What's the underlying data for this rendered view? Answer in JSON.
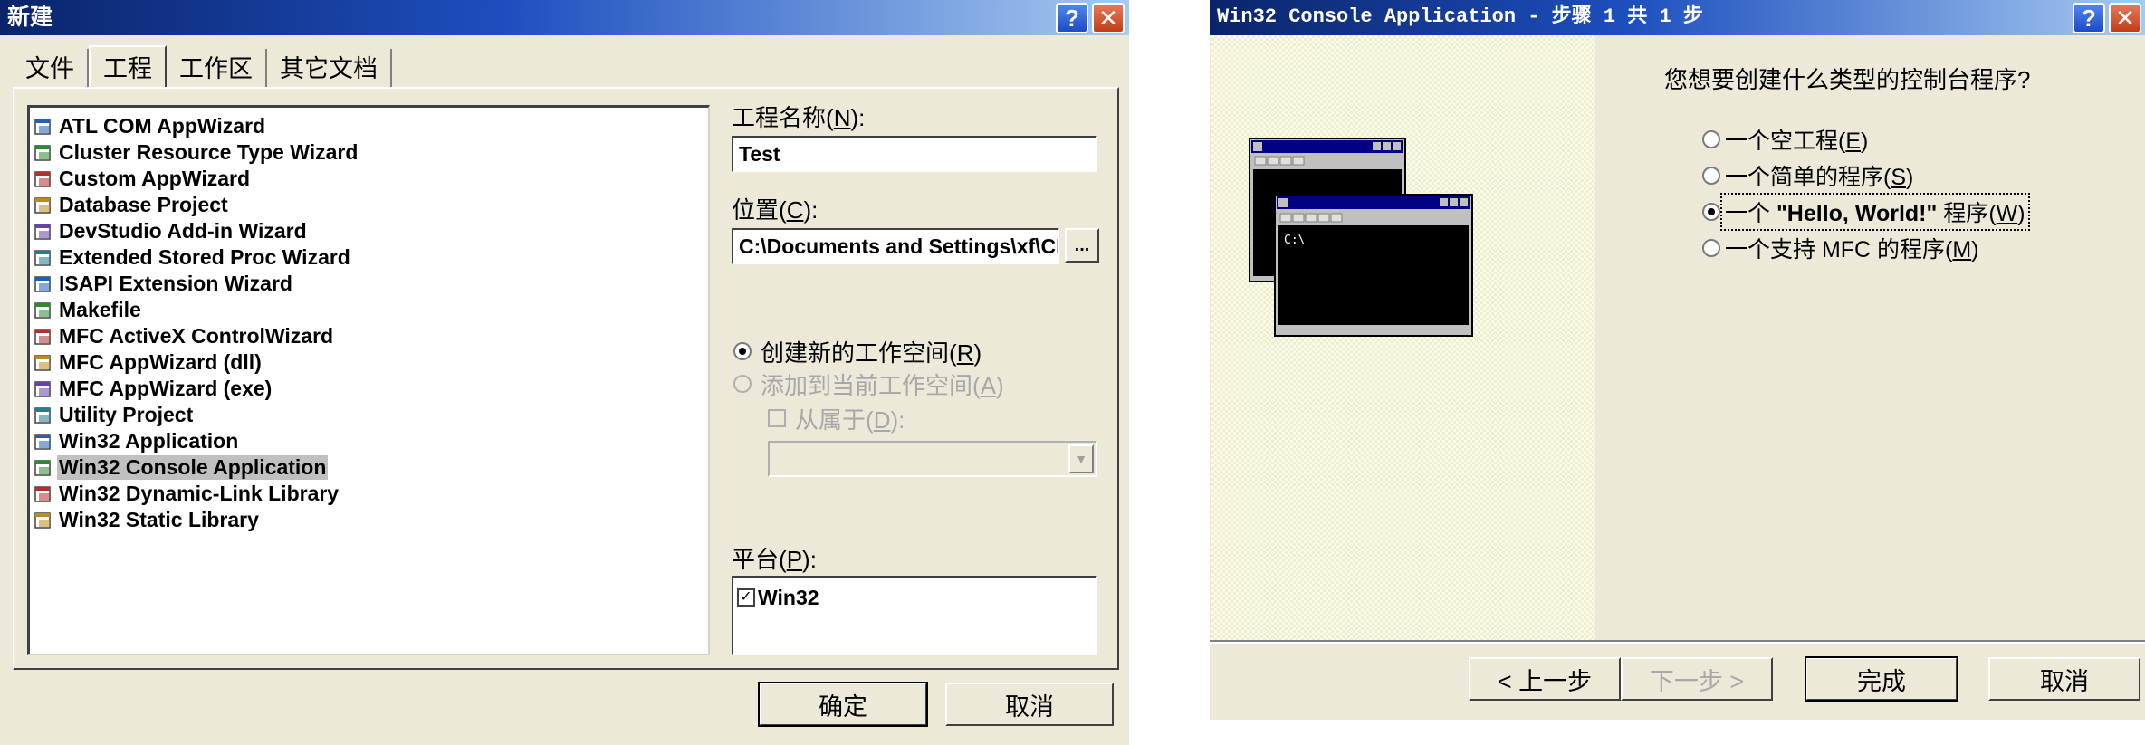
{
  "new_dialog": {
    "title": "新建",
    "help_btn": "?",
    "close_btn": "✕",
    "tabs": [
      "文件",
      "工程",
      "工作区",
      "其它文档"
    ],
    "active_tab": 1,
    "project_types": [
      "ATL COM AppWizard",
      "Cluster Resource Type Wizard",
      "Custom AppWizard",
      "Database Project",
      "DevStudio Add-in Wizard",
      "Extended Stored Proc Wizard",
      "ISAPI Extension Wizard",
      "Makefile",
      "MFC ActiveX ControlWizard",
      "MFC AppWizard (dll)",
      "MFC AppWizard (exe)",
      "Utility Project",
      "Win32 Application",
      "Win32 Console Application",
      "Win32 Dynamic-Link Library",
      "Win32 Static Library"
    ],
    "selected_project_type": "Win32 Console Application",
    "project_name": {
      "label": "工程名称",
      "hotkey": "N",
      "value": "Test"
    },
    "location": {
      "label": "位置",
      "hotkey": "C",
      "value": "C:\\Documents and Settings\\xf\\CF",
      "browse": "..."
    },
    "workspace_options": [
      {
        "label": "创建新的工作空间",
        "hotkey": "R",
        "selected": true,
        "enabled": true
      },
      {
        "label": "添加到当前工作空间",
        "hotkey": "A",
        "selected": false,
        "enabled": false
      }
    ],
    "dependency": {
      "label": "从属于",
      "hotkey": "D",
      "checked": false,
      "enabled": false
    },
    "platform": {
      "label": "平台",
      "hotkey": "P",
      "items": [
        {
          "label": "Win32",
          "checked": true
        }
      ]
    },
    "ok_button": "确定",
    "cancel_button": "取消"
  },
  "wizard_dialog": {
    "title": "Win32 Console Application - 步骤 1 共 1 步",
    "help_btn": "?",
    "close_btn": "✕",
    "question": "您想要创建什么类型的控制台程序?",
    "illustration_prompt": "C:\\",
    "options": [
      {
        "label": "一个空工程",
        "hotkey": "E",
        "selected": false
      },
      {
        "label": "一个简单的程序",
        "hotkey": "S",
        "selected": false
      },
      {
        "label_prefix": "一个 ",
        "label_bold": "\"Hello, World!\"",
        "label_suffix": " 程序",
        "hotkey": "W",
        "selected": true
      },
      {
        "label": "一个支持 MFC 的程序",
        "hotkey": "M",
        "selected": false
      }
    ],
    "back_button": "< 上一步",
    "next_button": "下一步 >",
    "finish_button": "完成",
    "cancel_button": "取消"
  }
}
